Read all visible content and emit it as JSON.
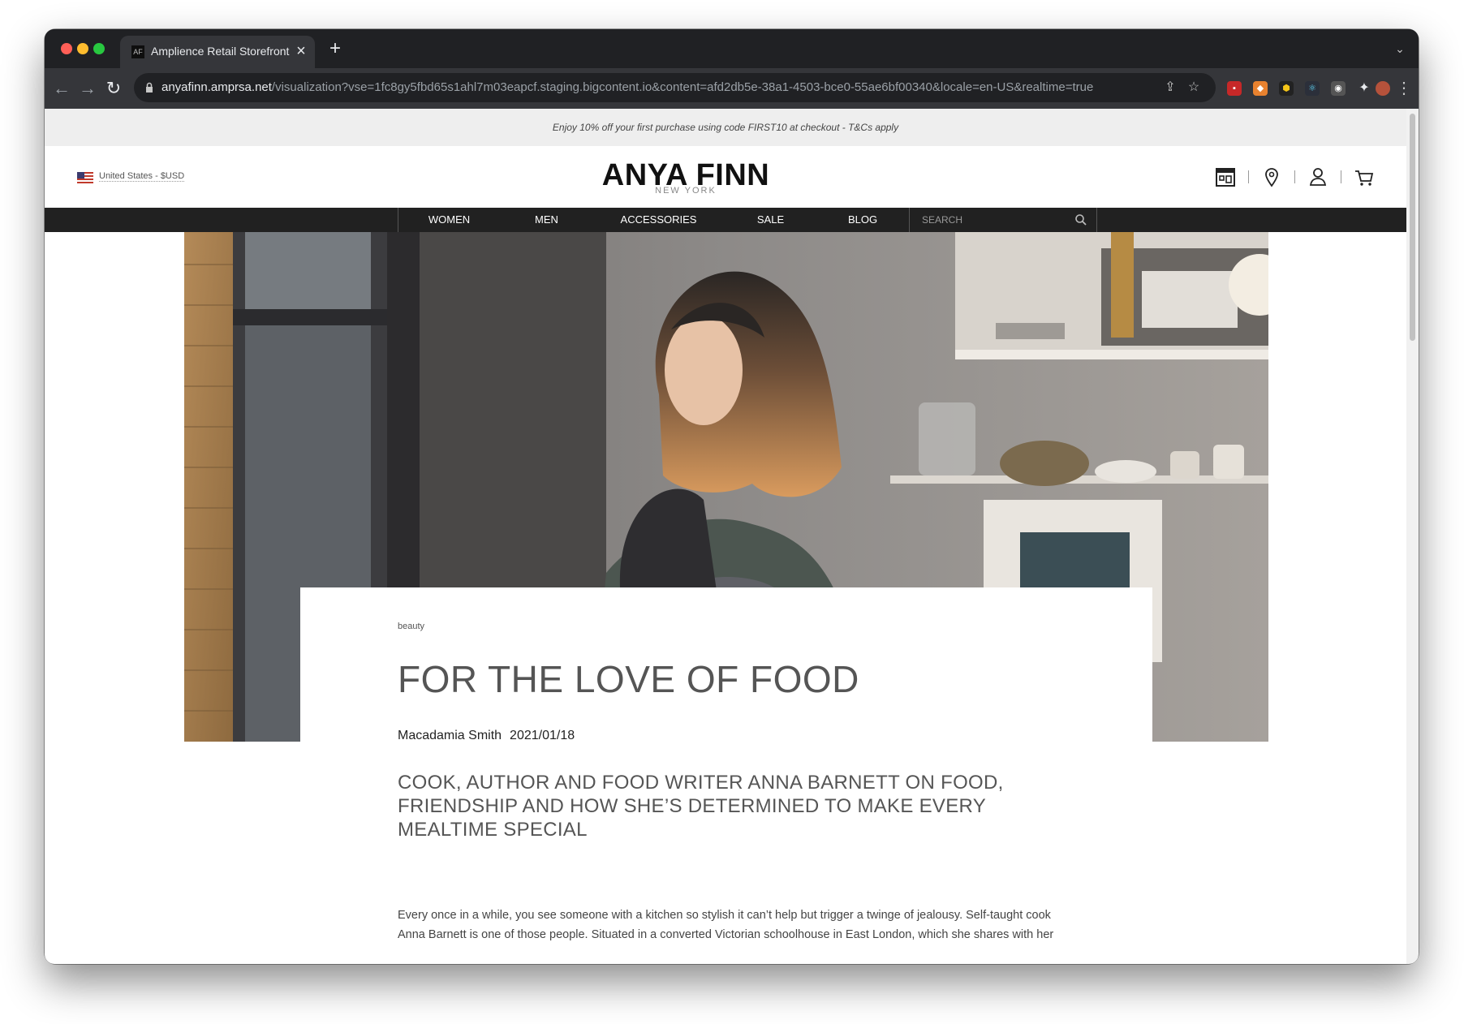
{
  "browser": {
    "tab_title": "Amplience Retail Storefront We",
    "tab_favicon": "AF",
    "url_host": "anyafinn.amprsa.net",
    "url_path": "/visualization?vse=1fc8gy5fbd65s1ahl7m03eapcf.staging.bigcontent.io&content=afd2db5e-38a1-4503-bce0-55ae6bf00340&locale=en-US&realtime=true"
  },
  "promo": {
    "text": "Enjoy 10% off your first purchase using code FIRST10 at checkout - T&Cs apply"
  },
  "header": {
    "locale": "United States - $USD",
    "logo_main": "ANYA FINN",
    "logo_sub": "NEW YORK"
  },
  "nav": {
    "items": [
      "WOMEN",
      "MEN",
      "ACCESSORIES",
      "SALE",
      "BLOG"
    ],
    "search_placeholder": "SEARCH"
  },
  "article": {
    "tag": "beauty",
    "title": "FOR THE LOVE OF FOOD",
    "author": "Macadamia Smith",
    "date": "2021/01/18",
    "subtitle": "COOK, AUTHOR AND FOOD WRITER ANNA BARNETT ON FOOD, FRIENDSHIP AND HOW SHE’S DETERMINED TO MAKE EVERY MEALTIME SPECIAL",
    "body": "Every once in a while, you see someone with a kitchen so stylish it can’t help but trigger a twinge of jealousy. Self-taught cook Anna Barnett is one of those people. Situated in a converted Victorian schoolhouse in East London, which she shares with her"
  },
  "icons": {
    "back": "back-arrow-icon",
    "forward": "forward-arrow-icon",
    "reload": "reload-icon",
    "share": "share-icon",
    "bookmark": "star-icon",
    "store": "store-icon",
    "location": "location-pin-icon",
    "account": "user-icon",
    "cart": "cart-icon",
    "search": "search-icon"
  },
  "colors": {
    "nav_bg": "#212121",
    "promo_bg": "#eeeeee",
    "title": "#555555"
  }
}
